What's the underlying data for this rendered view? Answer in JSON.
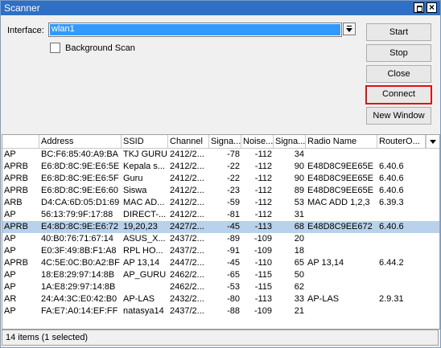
{
  "window": {
    "title": "Scanner"
  },
  "form": {
    "interface_label": "Interface:",
    "interface_value": "wlan1",
    "background_scan_label": "Background Scan",
    "background_scan_checked": false
  },
  "buttons": {
    "start": "Start",
    "stop": "Stop",
    "close": "Close",
    "connect": "Connect",
    "new_window": "New Window"
  },
  "table": {
    "columns": [
      "",
      "Address",
      "SSID",
      "Channel",
      "Signa...",
      "Noise...",
      "Signa...",
      "Radio Name",
      "RouterO..."
    ],
    "rows": [
      [
        "AP",
        "BC:F6:85:40:A9:BA",
        "TKJ GURU",
        "2412/2...",
        "-78",
        "-112",
        "34",
        "",
        ""
      ],
      [
        "APRB",
        "E6:8D:8C:9E:E6:5E",
        "Kepala s...",
        "2412/2...",
        "-22",
        "-112",
        "90",
        "E48D8C9EE65E",
        "6.40.6"
      ],
      [
        "APRB",
        "E6:8D:8C:9E:E6:5F",
        "Guru",
        "2412/2...",
        "-22",
        "-112",
        "90",
        "E48D8C9EE65E",
        "6.40.6"
      ],
      [
        "APRB",
        "E6:8D:8C:9E:E6:60",
        "Siswa",
        "2412/2...",
        "-23",
        "-112",
        "89",
        "E48D8C9EE65E",
        "6.40.6"
      ],
      [
        "ARB",
        "D4:CA:6D:05:D1:69",
        "MAC AD...",
        "2412/2...",
        "-59",
        "-112",
        "53",
        "MAC ADD 1,2,3",
        "6.39.3"
      ],
      [
        "AP",
        "56:13:79:9F:17:88",
        "DIRECT-...",
        "2412/2...",
        "-81",
        "-112",
        "31",
        "",
        ""
      ],
      [
        "APRB",
        "E4:8D:8C:9E:E6:72",
        "19,20,23",
        "2427/2...",
        "-45",
        "-113",
        "68",
        "E48D8C9EE672",
        "6.40.6"
      ],
      [
        "AP",
        "40:B0:76:71:67:14",
        "ASUS_X...",
        "2437/2...",
        "-89",
        "-109",
        "20",
        "",
        ""
      ],
      [
        "AP",
        "E0:3F:49:8B:F1:A8",
        "RPL HO...",
        "2437/2...",
        "-91",
        "-109",
        "18",
        "",
        ""
      ],
      [
        "APRB",
        "4C:5E:0C:B0:A2:BF",
        "AP 13,14",
        "2447/2...",
        "-45",
        "-110",
        "65",
        "AP 13,14",
        "6.44.2"
      ],
      [
        "AP",
        "18:E8:29:97:14:8B",
        "AP_GURU",
        "2462/2...",
        "-65",
        "-115",
        "50",
        "",
        ""
      ],
      [
        "AP",
        "1A:E8:29:97:14:8B",
        "",
        "2462/2...",
        "-53",
        "-115",
        "62",
        "",
        ""
      ],
      [
        "AR",
        "24:A4:3C:E0:42:B0",
        "AP-LAS",
        "2432/2...",
        "-80",
        "-113",
        "33",
        "AP-LAS",
        "2.9.31"
      ],
      [
        "AP",
        "FA:E7:A0:14:EF:FF",
        "natasya14",
        "2437/2...",
        "-88",
        "-109",
        "21",
        "",
        ""
      ]
    ],
    "selected_row": 6
  },
  "status": {
    "text": "14 items (1 selected)"
  },
  "icons": {
    "restore": "restore-icon",
    "close": "close-icon",
    "dropdown": "dropdown-arrow-icon",
    "column_menu": "column-menu-icon"
  },
  "colors": {
    "titlebar": "#2f6fc4",
    "selection": "#3399ff",
    "row_selected": "#b9d1ea",
    "connect_highlight": "#e01010"
  }
}
